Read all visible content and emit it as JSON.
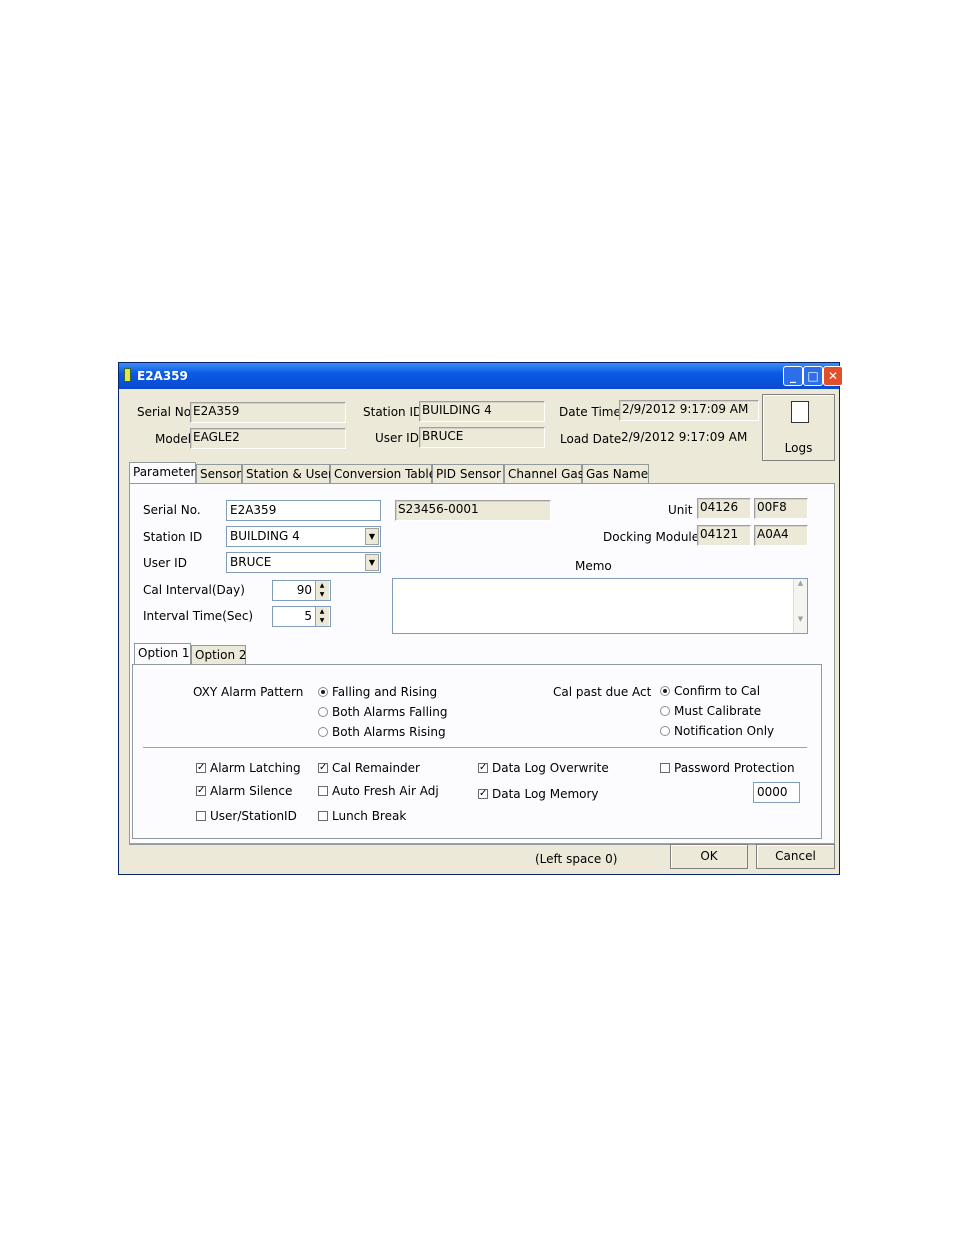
{
  "window": {
    "title": "E2A359"
  },
  "header": {
    "serial_label": "Serial No.",
    "serial_value": "E2A359",
    "model_label": "Model",
    "model_value": "EAGLE2",
    "station_label": "Station ID",
    "station_value": "BUILDING 4",
    "user_label": "User ID",
    "user_value": "BRUCE",
    "datetime_label": "Date Time",
    "datetime_value": "2/9/2012 9:17:09 AM",
    "loaddate_label": "Load Date",
    "loaddate_value": "2/9/2012 9:17:09 AM",
    "logs_label": "Logs"
  },
  "tabs": [
    "Parameter",
    "Sensor",
    "Station & User",
    "Conversion Table",
    "PID Sensor",
    "Channel Gas",
    "Gas Name"
  ],
  "parameter": {
    "serial_label": "Serial No.",
    "serial_value": "E2A359",
    "serial_extra": "S23456-0001",
    "station_label": "Station ID",
    "station_value": "BUILDING 4",
    "user_label": "User ID",
    "user_value": "BRUCE",
    "cal_interval_label": "Cal Interval(Day)",
    "cal_interval_value": "90",
    "interval_time_label": "Interval Time(Sec)",
    "interval_time_value": "5",
    "unit_label": "Unit",
    "unit_value1": "04126",
    "unit_value2": "00F8",
    "docking_label": "Docking Module",
    "docking_value1": "04121",
    "docking_value2": "A0A4",
    "memo_label": "Memo",
    "memo_value": ""
  },
  "subtabs": [
    "Option 1",
    "Option 2"
  ],
  "option1": {
    "oxy_label": "OXY Alarm Pattern",
    "oxy_options": [
      "Falling and Rising",
      "Both Alarms Falling",
      "Both Alarms Rising"
    ],
    "calpast_label": "Cal past due Act",
    "calpast_options": [
      "Confirm to Cal",
      "Must Calibrate",
      "Notification Only"
    ],
    "checks": {
      "alarm_latching": "Alarm Latching",
      "alarm_silence": "Alarm Silence",
      "user_station": "User/StationID",
      "cal_remainder": "Cal Remainder",
      "auto_fresh": "Auto Fresh Air Adj",
      "lunch_break": "Lunch Break",
      "data_log_overwrite": "Data Log Overwrite",
      "data_log_memory": "Data Log Memory",
      "password_protection": "Password Protection"
    },
    "password_value": "0000"
  },
  "footer": {
    "left_space": "(Left space 0)",
    "ok": "OK",
    "cancel": "Cancel"
  },
  "colors": {
    "titlebar": "#0a5ae6",
    "face": "#ece9d8",
    "panel": "#fcfcfe"
  }
}
